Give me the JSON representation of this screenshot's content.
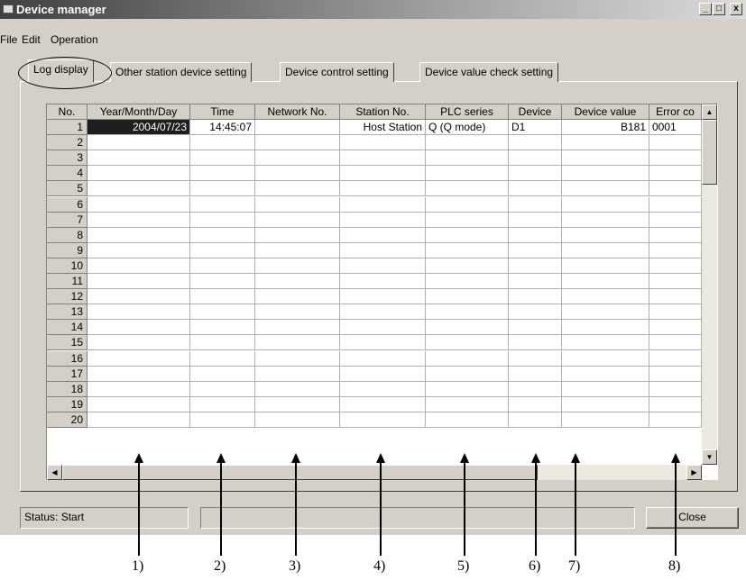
{
  "window": {
    "title": "Device manager",
    "minimize": "_",
    "maximize": "□",
    "close": "x"
  },
  "menu": [
    {
      "label": "File"
    },
    {
      "label": "Edit"
    },
    {
      "label": "Operation"
    }
  ],
  "tabs": [
    {
      "label": "Log display"
    },
    {
      "label": "Other station device setting"
    },
    {
      "label": "Device control setting"
    },
    {
      "label": "Device value check setting"
    }
  ],
  "visible_tab_labels": [
    "Log display",
    "Other station device setting",
    "Device control setting",
    "Device value check setting"
  ],
  "table": {
    "columns": [
      "No.",
      "Year/Month/Day",
      "Time",
      "Network No.",
      "Station No.",
      "PLC series",
      "Device",
      "Device value",
      "Error co"
    ],
    "rows": [
      [
        "1",
        "2004/07/23",
        "14:45:07",
        "",
        "Host Station",
        "Q (Q mode)",
        "D1",
        "B181",
        "0001"
      ],
      [
        "2",
        "",
        "",
        "",
        "",
        "",
        "",
        "",
        ""
      ],
      [
        "3",
        "",
        "",
        "",
        "",
        "",
        "",
        "",
        ""
      ],
      [
        "4",
        "",
        "",
        "",
        "",
        "",
        "",
        "",
        ""
      ],
      [
        "5",
        "",
        "",
        "",
        "",
        "",
        "",
        "",
        ""
      ],
      [
        "6",
        "",
        "",
        "",
        "",
        "",
        "",
        "",
        ""
      ],
      [
        "7",
        "",
        "",
        "",
        "",
        "",
        "",
        "",
        ""
      ],
      [
        "8",
        "",
        "",
        "",
        "",
        "",
        "",
        "",
        ""
      ],
      [
        "9",
        "",
        "",
        "",
        "",
        "",
        "",
        "",
        ""
      ],
      [
        "10",
        "",
        "",
        "",
        "",
        "",
        "",
        "",
        ""
      ],
      [
        "11",
        "",
        "",
        "",
        "",
        "",
        "",
        "",
        ""
      ],
      [
        "12",
        "",
        "",
        "",
        "",
        "",
        "",
        "",
        ""
      ],
      [
        "13",
        "",
        "",
        "",
        "",
        "",
        "",
        "",
        ""
      ],
      [
        "14",
        "",
        "",
        "",
        "",
        "",
        "",
        "",
        ""
      ],
      [
        "15",
        "",
        "",
        "",
        "",
        "",
        "",
        "",
        ""
      ],
      [
        "16",
        "",
        "",
        "",
        "",
        "",
        "",
        "",
        ""
      ],
      [
        "17",
        "",
        "",
        "",
        "",
        "",
        "",
        "",
        ""
      ],
      [
        "18",
        "",
        "",
        "",
        "",
        "",
        "",
        "",
        ""
      ],
      [
        "19",
        "",
        "",
        "",
        "",
        "",
        "",
        "",
        ""
      ],
      [
        "20",
        "",
        "",
        "",
        "",
        "",
        "",
        "",
        ""
      ]
    ]
  },
  "status": {
    "text": "Status: Start"
  },
  "close_button": {
    "label": "Close"
  },
  "annotations": [
    "1)",
    "2)",
    "3)",
    "4)",
    "5)",
    "6)",
    "7)",
    "8)"
  ]
}
